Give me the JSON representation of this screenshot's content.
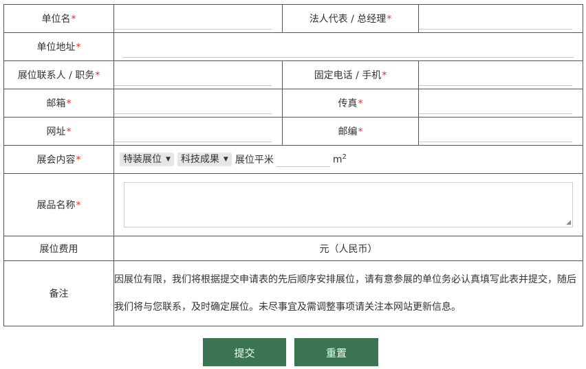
{
  "form": {
    "unit_name": {
      "label": "单位名",
      "required": "*"
    },
    "legal_rep": {
      "label": "法人代表 / 总经理",
      "required": "*"
    },
    "address": {
      "label": "单位地址",
      "required": "*"
    },
    "contact": {
      "label": "展位联系人 / 职务",
      "required": "*"
    },
    "phone": {
      "label": "固定电话 / 手机",
      "required": "*"
    },
    "email": {
      "label": "邮箱",
      "required": "*"
    },
    "fax": {
      "label": "传真",
      "required": "*"
    },
    "website": {
      "label": "网址",
      "required": "*"
    },
    "postcode": {
      "label": "邮编",
      "required": "*"
    },
    "content": {
      "label": "展会内容",
      "required": "*",
      "booth_type_selected": "特装展位",
      "category_selected": "科技成果",
      "area_label": "展位平米",
      "unit": "m",
      "unit_sup": "2"
    },
    "exhibits": {
      "label": "展品名称",
      "required": "*"
    },
    "fee": {
      "label": "展位费用",
      "value": "元（人民币）"
    },
    "note": {
      "label": "备注",
      "text": "因展位有限，我们将根据提交申请表的先后顺序安排展位，请有意参展的单位务必认真填写此表并提交，随后我们将与您联系，及时确定展位。未尽事宜及需调整事项请关注本网站更新信息。"
    }
  },
  "buttons": {
    "submit": "提交",
    "reset": "重置"
  },
  "colors": {
    "button_bg": "#3b7450",
    "required_mark": "#e0302a"
  }
}
